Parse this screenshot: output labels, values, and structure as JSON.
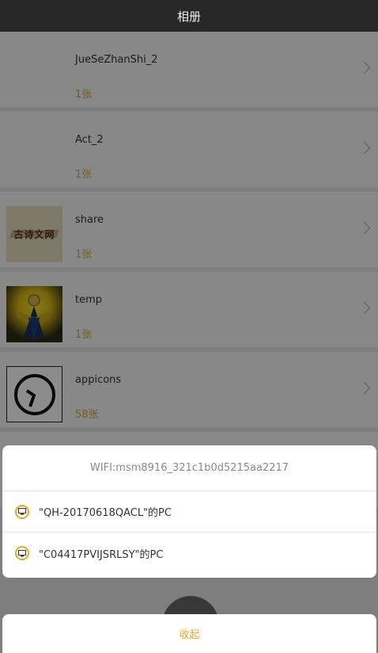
{
  "header": {
    "title": "相册"
  },
  "albums": [
    {
      "name": "JueSeZhanShi_2",
      "count": "1张"
    },
    {
      "name": "Act_2",
      "count": "1张"
    },
    {
      "name": "share",
      "count": "1张",
      "thumb_text": "古诗文网"
    },
    {
      "name": "temp",
      "count": "1张"
    },
    {
      "name": "appicons",
      "count": "58张"
    }
  ],
  "dialog": {
    "title": "WIFI:msm8916_321c1b0d5215aa2217",
    "items": [
      {
        "label": "\"QH-20170618QACL\"的PC"
      },
      {
        "label": "\"C04417PVIJSRLSY\"的PC"
      }
    ]
  },
  "cancel_label": "收起",
  "colors": {
    "accent": "#e6a929",
    "count": "#d9a82a"
  }
}
